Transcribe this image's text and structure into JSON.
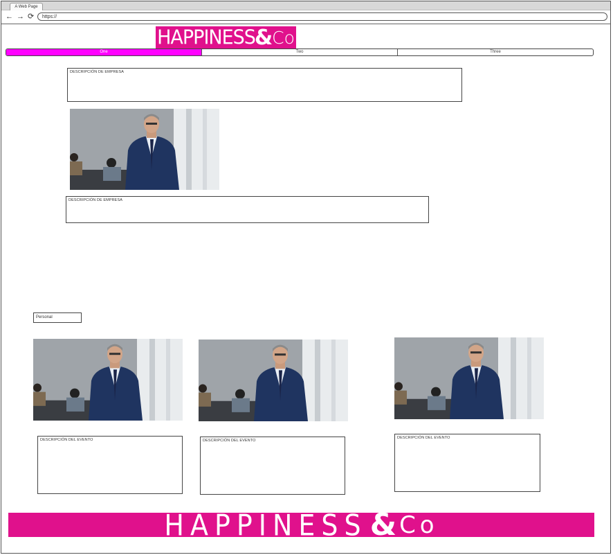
{
  "browser": {
    "tab_title": "A Web Page",
    "url": "https://",
    "back_icon": "←",
    "forward_icon": "→",
    "reload_icon": "⟳"
  },
  "brand": {
    "word": "HAPPINESS",
    "amp": "&",
    "co": "Co",
    "color": "#e0118c"
  },
  "nav": {
    "items": [
      "One",
      "Two",
      "Three"
    ],
    "active_index": 0,
    "active_color": "#ff00ff"
  },
  "company": {
    "description_1": "DESCRIPCIÓN DE EMPRESA",
    "description_2": "DESCRIPCIÓN DE EMPRESA"
  },
  "personal": {
    "label": "Personal"
  },
  "events": [
    {
      "description": "DESCRIPCIÓN DEL EVENTO"
    },
    {
      "description": "DESCRIPCIÓN DEL EVENTO"
    },
    {
      "description": "DESCRIPCIÓN DEL EVENTO"
    }
  ]
}
